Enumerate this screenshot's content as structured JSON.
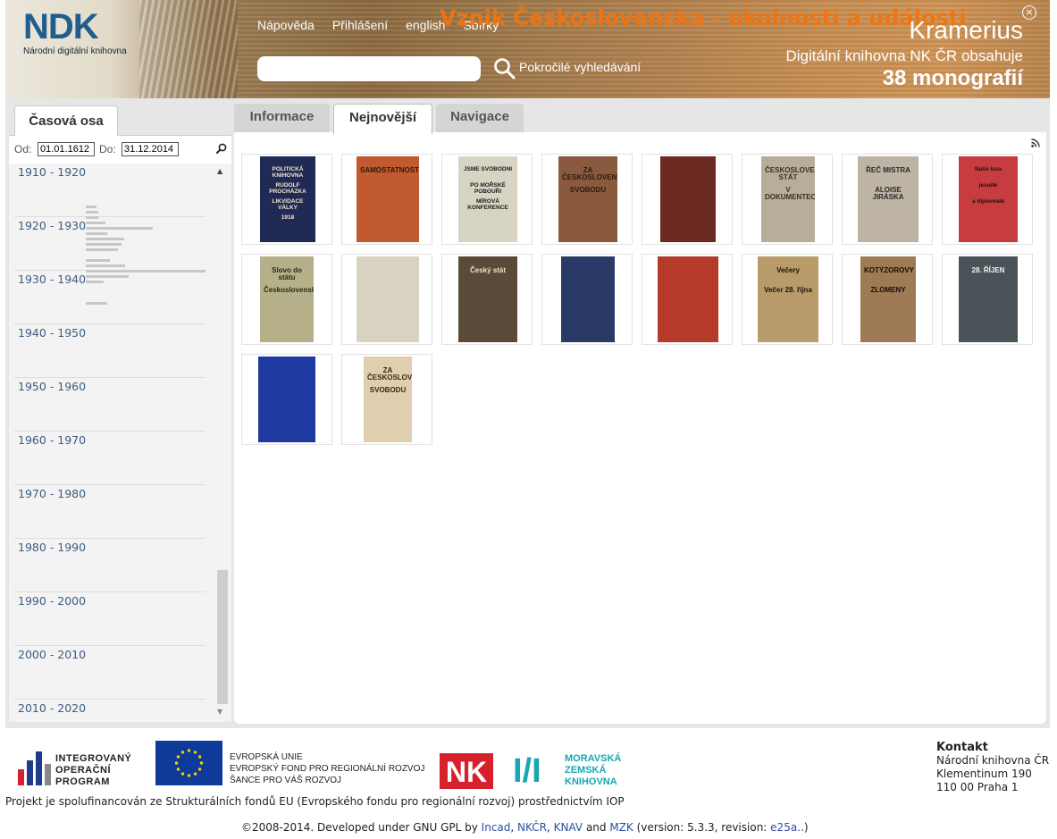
{
  "header": {
    "logo_text": "NDK",
    "logo_sub": "Národní digitální knihovna",
    "nav": [
      "Nápověda",
      "Přihlášení",
      "english",
      "Sbírky"
    ],
    "collection_title": "Vznik Československa - okolnosti a události",
    "search_placeholder": "",
    "advanced_search": "Pokročilé vyhledávání",
    "app_name": "Kramerius",
    "library_line": "Digitální knihovna NK ČR obsahuje",
    "count_line": "38 monografií",
    "close_symbol": "×"
  },
  "timeline": {
    "tab_label": "Časová osa",
    "from_label": "Od:",
    "from_value": "01.01.1612",
    "to_label": "Do:",
    "to_value": "31.12.2014",
    "decades": [
      "1910 - 1920",
      "1920 - 1930",
      "1930 - 1940",
      "1940 - 1950",
      "1950 - 1960",
      "1960 - 1970",
      "1970 - 1980",
      "1980 - 1990",
      "1990 - 2000",
      "2000 - 2010",
      "2010 - 2020"
    ]
  },
  "tabs": [
    {
      "label": "Informace",
      "active": false
    },
    {
      "label": "Nejnovější",
      "active": true
    },
    {
      "label": "Navigace",
      "active": false
    }
  ],
  "thumbnails": [
    {
      "lines": [
        "POLITICKÁ KNIHOVNA",
        "RUDOLF PROCHÁZKA",
        "LIKVIDACE VÁLKY",
        "1918"
      ],
      "bg": "#1f2a55",
      "fg": "#f3e7c8"
    },
    {
      "lines": [
        "SAMOSTATNOST"
      ],
      "bg": "#c25a30",
      "fg": "#2a1a0a"
    },
    {
      "lines": [
        "JSME SVOBODNI",
        "PO MOŘSKÉ POBOUŘI",
        "MÍROVÁ KONFERENCE"
      ],
      "bg": "#d8d4c4",
      "fg": "#1a1a1a"
    },
    {
      "lines": [
        "ZA ČESKOSLOVENSKOU",
        "SVOBODU"
      ],
      "bg": "#8a5a3f",
      "fg": "#2a1a10"
    },
    {
      "lines": [],
      "bg": "#6b2b22",
      "fg": "#c9a38b"
    },
    {
      "lines": [
        "ČESKOSLOVENSKÝ STÁT",
        "V DOKUMENTECH"
      ],
      "bg": "#b8ad98",
      "fg": "#3a3020"
    },
    {
      "lines": [
        "ŘEČ MISTRA",
        "ALOISE JIRÁSKA"
      ],
      "bg": "#bdb4a5",
      "fg": "#2a2a2a"
    },
    {
      "lines": [
        "Naše luza",
        "jesuité",
        "a diplomaté"
      ],
      "bg": "#c73d3f",
      "fg": "#1c1010"
    },
    {
      "lines": [
        "Slovo do státu",
        "Československa."
      ],
      "bg": "#b5b08a",
      "fg": "#2a2a10"
    },
    {
      "lines": [],
      "bg": "#d8d2c0",
      "fg": "#5a5040"
    },
    {
      "lines": [
        "Český stát"
      ],
      "bg": "#5a4a38",
      "fg": "#eee3c8"
    },
    {
      "lines": [],
      "bg": "#2a3a66",
      "fg": "#c0c8e0"
    },
    {
      "lines": [],
      "bg": "#b53a2a",
      "fg": "#f0c0a0"
    },
    {
      "lines": [
        "Večery",
        "Večer 28. října"
      ],
      "bg": "#b99b6a",
      "fg": "#1a1208"
    },
    {
      "lines": [
        "KOTÝZOROVY",
        "ZLOMENY"
      ],
      "bg": "#9e7a55",
      "fg": "#1a0a04"
    },
    {
      "lines": [
        "28. ŘÍJEN"
      ],
      "bg": "#4a5458",
      "fg": "#f4f4f4"
    },
    {
      "lines": [],
      "bg": "#1f3aa0",
      "fg": "#b8c8f0"
    },
    {
      "lines": [
        "ZA ČESKOSLOVENSKOU",
        "SVOBODU"
      ],
      "bg": "#dfcfae",
      "fg": "#3a2a10"
    }
  ],
  "footer": {
    "iop_lines": [
      "INTEGROVANÝ",
      "OPERAČNÍ",
      "PROGRAM"
    ],
    "eu_lines": [
      "EVROPSKÁ UNIE",
      "EVROPSKÝ FOND PRO REGIONÁLNÍ ROZVOJ",
      "ŠANCE PRO VÁŠ ROZVOJ"
    ],
    "nk_logo": "NK",
    "mzk_mark": "I/I",
    "mzk_lines": [
      "MORAVSKÁ",
      "ZEMSKÁ",
      "KNIHOVNA"
    ],
    "project_note": "Projekt je spolufinancován ze Strukturálních fondů EU (Evropského fondu pro regionální rozvoj) prostřednictvím IOP",
    "contact_title": "Kontakt",
    "contact_lines": [
      "Národní knihovna ČR",
      "Klementinum 190",
      "110 00 Praha 1"
    ],
    "copyright_pre": "©2008-2014. Developed under GNU GPL by",
    "links": [
      "Incad",
      "NKČR",
      "KNAV",
      "MZK"
    ],
    "and": "and",
    "comma": ",",
    "version_pre": "(version: 5.3.3, revision:",
    "revision": "e25a..",
    "version_post": ")"
  }
}
